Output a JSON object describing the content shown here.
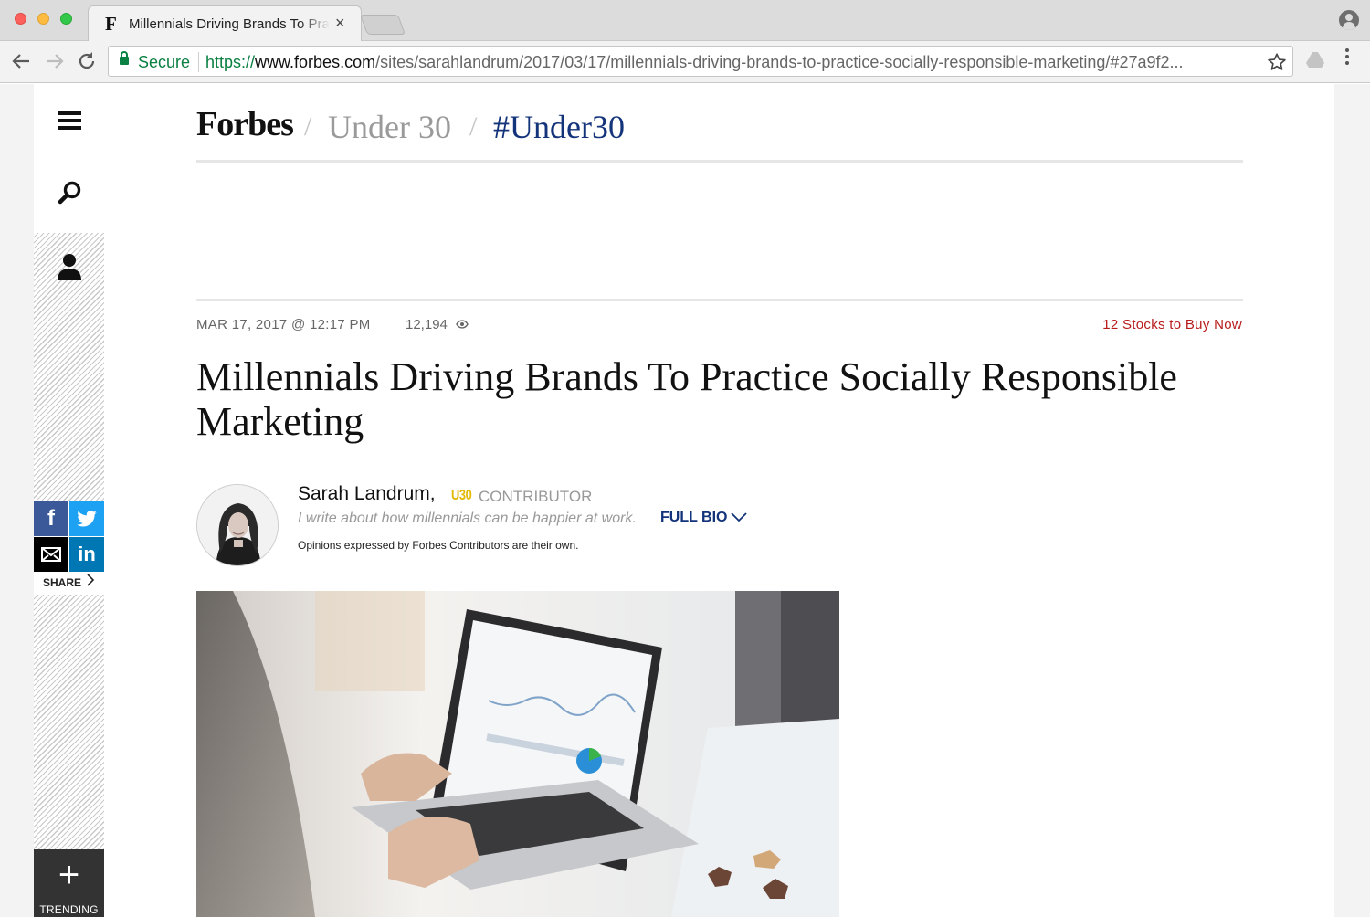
{
  "browser": {
    "tab_favicon": "F",
    "tab_title": "Millennials Driving Brands To Practice Socially Responsible Marketing",
    "tab_close": "×",
    "secure_label": "Secure",
    "url_scheme": "https://",
    "url_host": "www.forbes.com",
    "url_path": "/sites/sarahlandrum/2017/03/17/millennials-driving-brands-to-practice-socially-responsible-marketing/#27a9f2...",
    "icons": [
      "back-arrow-icon",
      "forward-arrow-icon",
      "reload-icon",
      "lock-icon",
      "star-icon",
      "drive-extension-icon",
      "menu-dots-icon",
      "profile-icon"
    ]
  },
  "header": {
    "brand": "Forbes",
    "separator": "/",
    "crumbs": [
      "Under 30",
      "#Under30"
    ]
  },
  "rail": {
    "share_label": "SHARE",
    "share_icons": [
      "facebook-icon",
      "twitter-icon",
      "email-icon",
      "linkedin-icon"
    ],
    "facebook_glyph": "f",
    "linkedin_glyph": "in",
    "trending_label": "TRENDING",
    "trending_glyph": "+"
  },
  "article": {
    "date": "MAR 17, 2017 @ 12:17 PM",
    "views": "12,194",
    "promo_link": "12 Stocks to Buy Now",
    "headline": "Millennials Driving Brands To Practice Socially Responsible Marketing",
    "author_name": "Sarah Landrum,",
    "author_badge": "U30",
    "author_role": "CONTRIBUTOR",
    "author_bio": "I write about how millennials can be happier at work.",
    "full_bio_label": "FULL BIO",
    "disclaimer": "Opinions expressed by Forbes Contributors are their own."
  },
  "colors": {
    "forbes_navy": "#13337a",
    "promo_red": "#b71c1c",
    "u30_gold": "#e3b800",
    "facebook": "#3b5998",
    "twitter": "#1da1f2",
    "linkedin": "#0077b5",
    "secure_green": "#0b8043"
  }
}
